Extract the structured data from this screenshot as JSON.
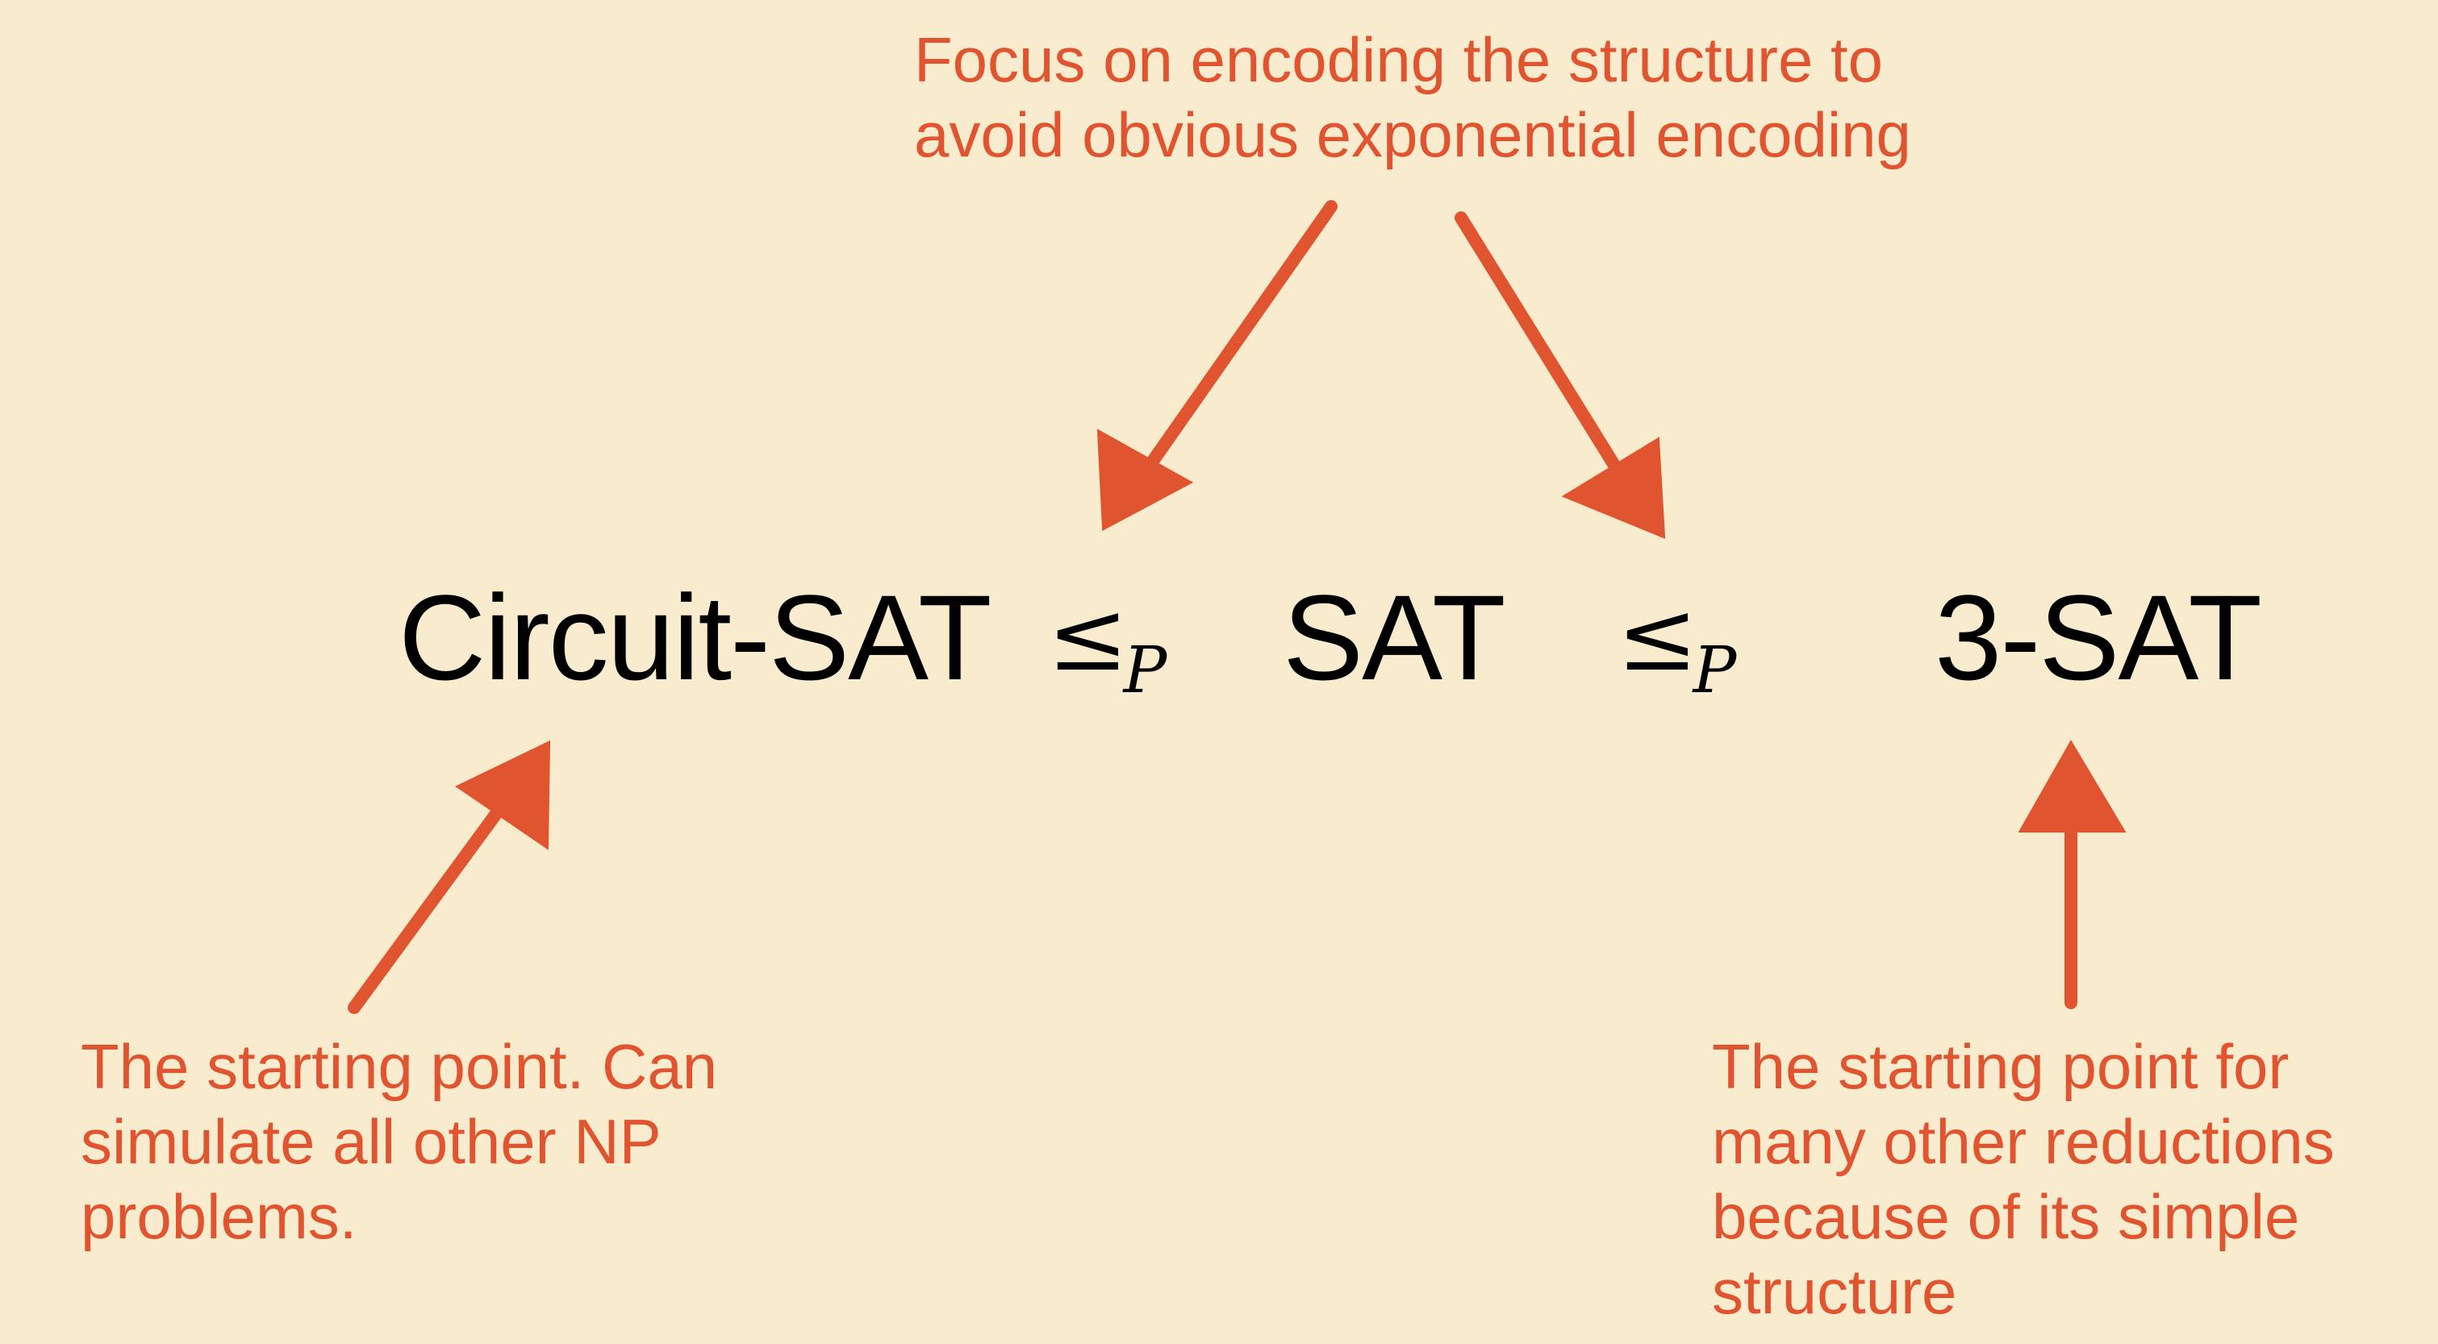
{
  "colors": {
    "background": "#F9EBCD",
    "accent": "#E0552F",
    "text": "#000000"
  },
  "top_note": {
    "lines": [
      "Focus on encoding the structure to",
      "avoid obvious exponential encoding"
    ]
  },
  "formula": {
    "term1": "Circuit-SAT",
    "leq_symbol": "≤",
    "leq_sub": "P",
    "term2": "SAT",
    "term3": "3-SAT"
  },
  "left_note": {
    "lines": [
      "The starting point. Can",
      "simulate all other NP",
      "problems."
    ]
  },
  "right_note": {
    "lines": [
      "The starting point for",
      "many other reductions",
      "because of its simple",
      "structure"
    ]
  }
}
